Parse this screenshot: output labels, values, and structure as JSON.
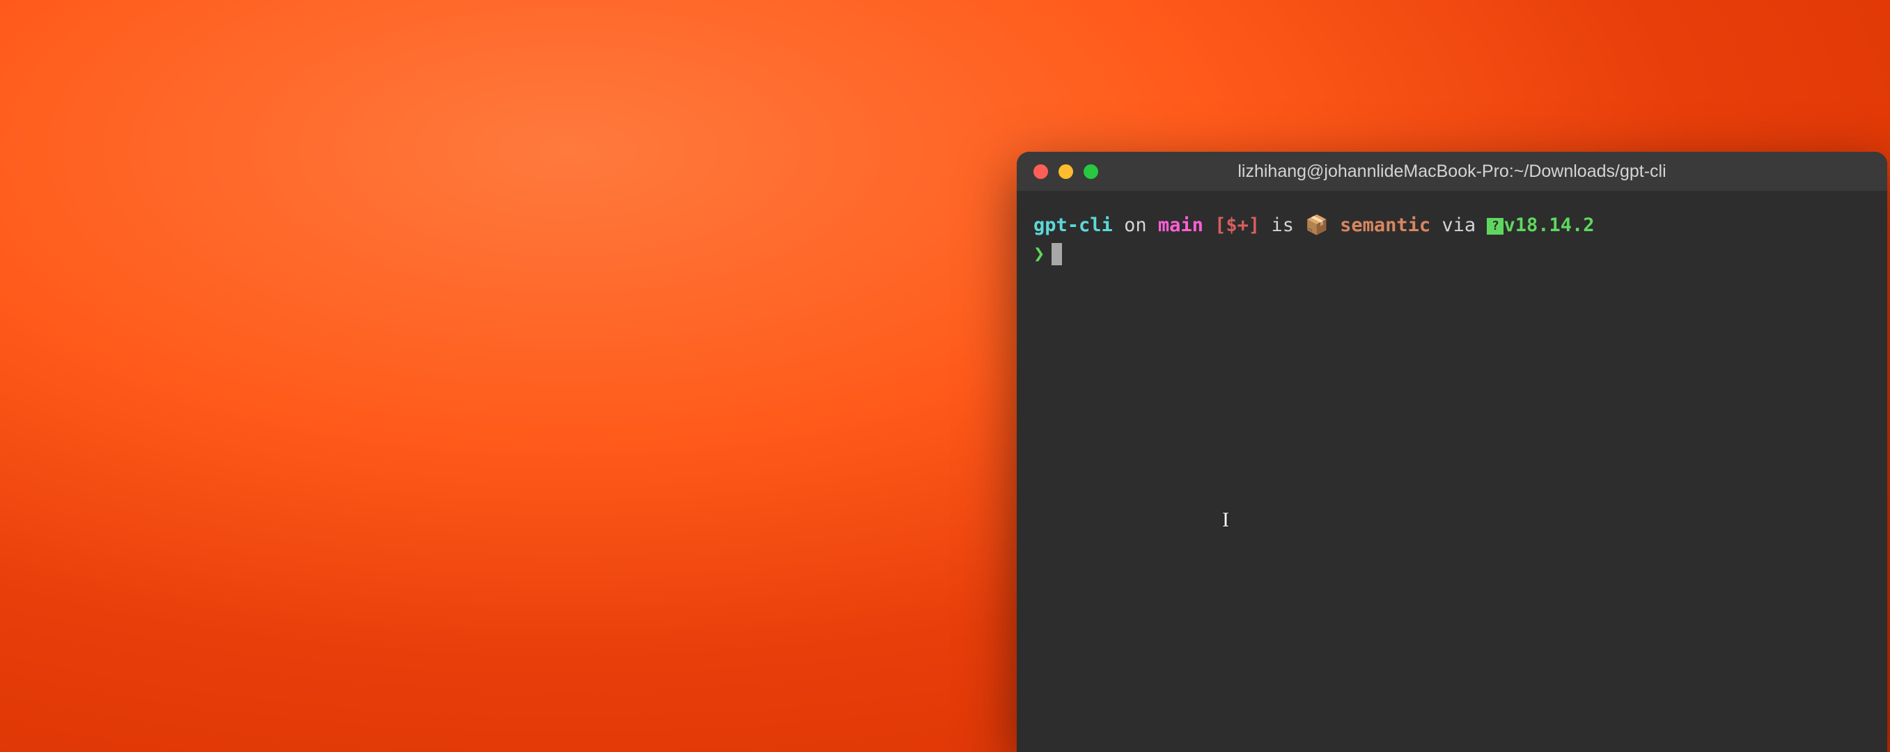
{
  "window": {
    "title": "lizhihang@johannlideMacBook-Pro:~/Downloads/gpt-cli"
  },
  "prompt": {
    "directory": "gpt-cli",
    "on_text": "on",
    "branch_glyph": "",
    "branch": "main",
    "git_status": "[$+]",
    "is_text": "is",
    "package_glyph": "📦",
    "semver": "semantic",
    "via_text": "via",
    "node_glyph": "?",
    "node_version": "v18.14.2",
    "symbol": "❯"
  },
  "cursor_glyph": "I"
}
